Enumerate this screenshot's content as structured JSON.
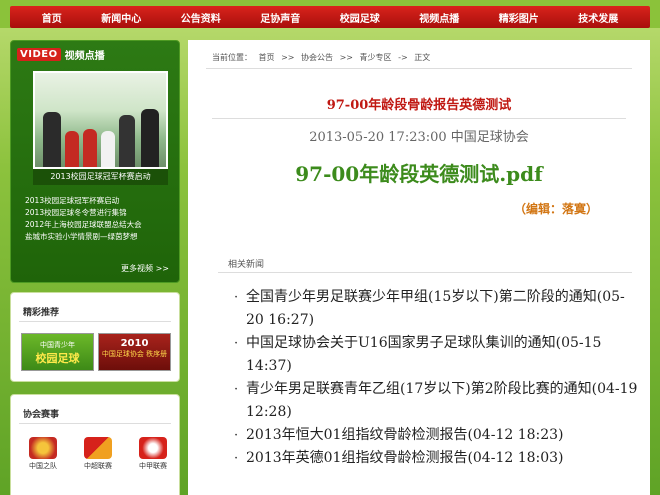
{
  "nav": [
    "首页",
    "新闻中心",
    "公告资料",
    "足协声音",
    "校园足球",
    "视频点播",
    "精彩图片",
    "技术发展"
  ],
  "video": {
    "tag": "VIDEO",
    "title": "视频点播",
    "caption": "2013校园足球冠军杯赛启动",
    "links": [
      "2013校园足球冠军杯赛启动",
      "2013校园足球冬令营进行集锦",
      "2012年上海校园足球联盟总结大会",
      "盐城市实验小学情景剧—绿茵梦想"
    ],
    "more": "更多视频 >>"
  },
  "featured": {
    "title": "精彩推荐",
    "promo1_top": "中国青少年",
    "promo1_main": "校园足球",
    "promo2_top": "2010",
    "promo2_main": "中国足球协会 秩序册"
  },
  "leagues": {
    "title": "协会赛事",
    "items": [
      "中国之队",
      "中超联赛",
      "中甲联赛"
    ]
  },
  "breadcrumb": {
    "label": "当前位置：",
    "items": [
      "首页",
      ">>",
      "协会公告",
      ">>",
      "青少专区",
      "->",
      "正文"
    ]
  },
  "article": {
    "title": "97-00年龄段骨龄报告英德测试",
    "meta": "2013-05-20 17:23:00  中国足球协会",
    "file": "97-00年龄段英德测试.pdf",
    "editor": "（编辑：落寞）"
  },
  "related": {
    "heading": "相关新闻",
    "items": [
      "全国青少年男足联赛少年甲组(15岁以下)第二阶段的通知(05-20 16:27)",
      "中国足球协会关于U16国家男子足球队集训的通知(05-15 14:37)",
      "青少年男足联赛青年乙组(17岁以下)第2阶段比赛的通知(04-19 12:28)",
      "2013年恒大01组指纹骨龄检测报告(04-12 18:23)",
      "2013年英德01组指纹骨龄检测报告(04-12 18:03)"
    ]
  },
  "colors": {
    "nav_red": "#c01812",
    "title_red": "#c01812",
    "file_green": "#3c8b1c",
    "editor_orange": "#d27614",
    "page_green": "#8bc23a"
  }
}
